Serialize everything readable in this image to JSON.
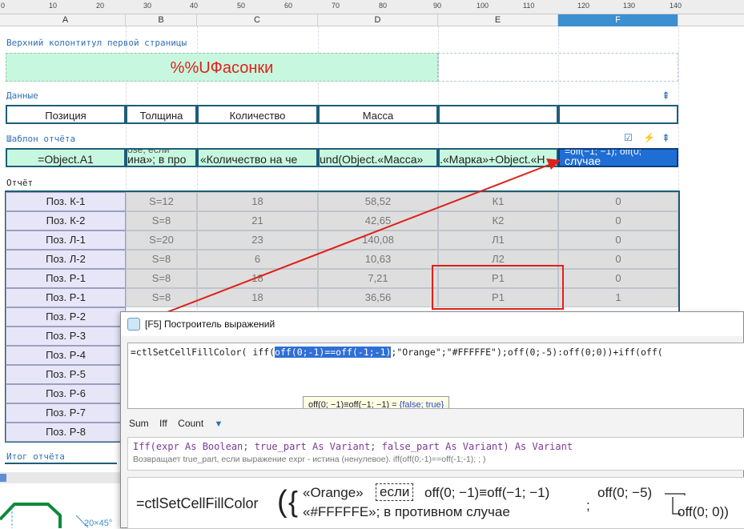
{
  "ruler": {
    "ticks": [
      "0",
      "10",
      "20",
      "30",
      "40",
      "50",
      "60",
      "70",
      "80",
      "90",
      "100",
      "110",
      "120",
      "130",
      "140"
    ]
  },
  "columns": [
    "A",
    "B",
    "C",
    "D",
    "E",
    "F"
  ],
  "sections": {
    "header": "Верхний колонтитул первой страницы",
    "data": "Данные",
    "template": "Шаблон отчёта",
    "report": "Отчёт",
    "footer": "Итог отчёта"
  },
  "title_cell": "%%UФасонки",
  "data_headers": [
    "Позиция",
    "Толщина",
    "Количество",
    "Масса",
    "",
    ""
  ],
  "template_cells": [
    "=Object.A1",
    "ина»; в про",
    "«Количество на че",
    "und(Object.«Масса»",
    ".«Марка»+Object.«Н",
    "случае"
  ],
  "template_cells_top": [
    "",
    "ose, если",
    "",
    "",
    "",
    "=off(−1; −1); off(0;"
  ],
  "report_rows": [
    {
      "pos": "Поз. К-1",
      "thk": "S=12",
      "qty": "18",
      "mass": "58,52",
      "mark": "К1",
      "f": "0"
    },
    {
      "pos": "Поз. К-2",
      "thk": "S=8",
      "qty": "21",
      "mass": "42,65",
      "mark": "К2",
      "f": "0"
    },
    {
      "pos": "Поз. Л-1",
      "thk": "S=20",
      "qty": "23",
      "mass": "140,08",
      "mark": "Л1",
      "f": "0"
    },
    {
      "pos": "Поз. Л-2",
      "thk": "S=8",
      "qty": "6",
      "mass": "10,63",
      "mark": "Л2",
      "f": "0"
    },
    {
      "pos": "Поз. Р-1",
      "thk": "S=8",
      "qty": "18",
      "mass": "7,21",
      "mark": "Р1",
      "f": "0"
    },
    {
      "pos": "Поз. Р-1",
      "thk": "S=8",
      "qty": "18",
      "mass": "36,56",
      "mark": "Р1",
      "f": "1"
    },
    {
      "pos": "Поз. Р-2"
    },
    {
      "pos": "Поз. Р-3"
    },
    {
      "pos": "Поз. Р-4"
    },
    {
      "pos": "Поз. Р-5"
    },
    {
      "pos": "Поз. Р-6"
    },
    {
      "pos": "Поз. Р-7"
    },
    {
      "pos": "Поз. Р-8"
    }
  ],
  "drawing_label": "20×45°",
  "dialog": {
    "title": "[F5] Построитель выражений",
    "expr_pre": "=ctlSetCellFillColor( iff(",
    "expr_sel": "off(0;-1)==off(-1;-1)",
    "expr_post": ";\"Orange\";\"#FFFFFE\");off(0;-5):off(0;0))+iff(off(",
    "tooltip_expr": "off(0; −1)≡off(−1; −1)",
    "tooltip_eq": " = ",
    "tooltip_res": "{false; true}",
    "fn_buttons": [
      "Sum",
      "Iff",
      "Count"
    ],
    "signature": "Iff(expr As Boolean; true_part As Variant; false_part As Variant) As Variant",
    "description": "Возвращает true_part, если выражение expr - истина (ненулевое). iff(off(0;-1)==off(-1;-1); ; )",
    "pretty": {
      "fn": "=ctlSetCellFillColor",
      "orange": "«Orange»",
      "if_word": "если",
      "cond": "off(0; −1)≡off(−1; −1)",
      "white": "«#FFFFFE»; в противном случае",
      "sep": ";",
      "off1": "off(0; −5)",
      "off2": "off(0; 0))"
    }
  },
  "colors": {
    "highlight": "#2f6fd6",
    "arrow": "#e0201a",
    "frame": "#1d5e78",
    "template_fill": "#c8f7df"
  }
}
